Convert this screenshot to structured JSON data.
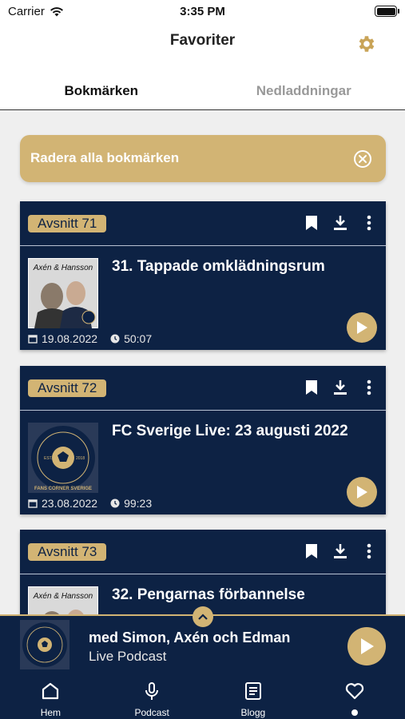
{
  "status_bar": {
    "carrier": "Carrier",
    "time": "3:35 PM"
  },
  "header": {
    "title": "Favoriter",
    "settings_icon": "gear-icon"
  },
  "tabs": [
    {
      "label": "Bokmärken",
      "active": true
    },
    {
      "label": "Nedladdningar",
      "active": false
    }
  ],
  "delete_all": {
    "label": "Radera alla bokmärken"
  },
  "episodes": [
    {
      "badge": "Avsnitt 71",
      "title": "31. Tappade omklädningsrum",
      "date": "19.08.2022",
      "duration": "50:07",
      "thumb_caption": "Axén & Hansson"
    },
    {
      "badge": "Avsnitt 72",
      "title": "FC Sverige Live: 23 augusti 2022",
      "date": "23.08.2022",
      "duration": "99:23",
      "thumb_caption": "FANS CORNER SVERIGE"
    },
    {
      "badge": "Avsnitt 73",
      "title": "32. Pengarnas förbannelse",
      "date": "",
      "duration": "",
      "thumb_caption": "Axén & Hansson"
    }
  ],
  "player": {
    "title": "med Simon, Axén och Edman",
    "subtitle": "Live Podcast"
  },
  "tabbar": [
    {
      "label": "Hem",
      "icon": "home-icon"
    },
    {
      "label": "Podcast",
      "icon": "microphone-icon"
    },
    {
      "label": "Blogg",
      "icon": "blog-icon"
    },
    {
      "label": "",
      "icon": "heart-icon",
      "active": true
    }
  ],
  "colors": {
    "navy": "#0d2244",
    "gold": "#d2b474",
    "background": "#efefef"
  }
}
